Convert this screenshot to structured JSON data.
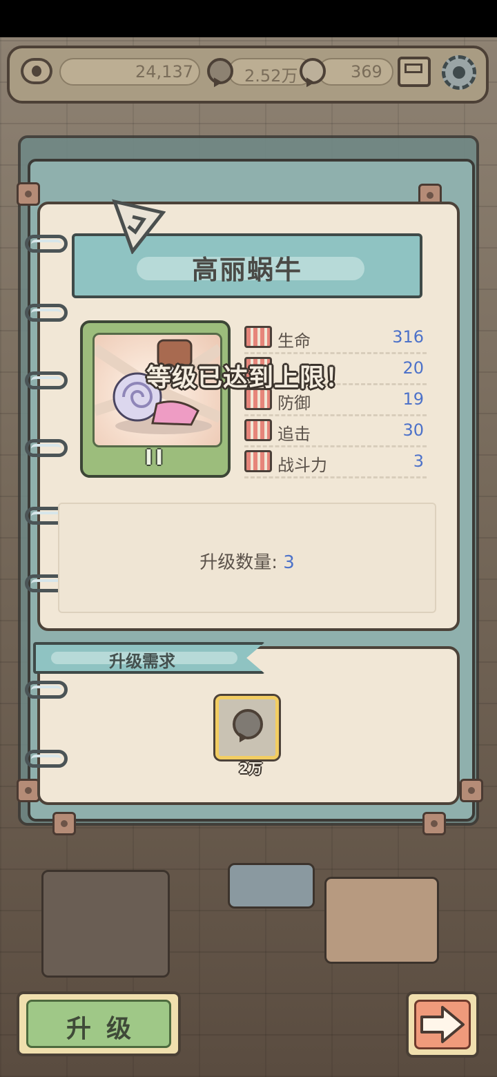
{
  "resources": {
    "views": "24,137",
    "bubbles": "2.52万",
    "gems": "369"
  },
  "card": {
    "title": "高丽蜗牛",
    "level_roman": "II",
    "stats": [
      {
        "label": "生命",
        "value": "316",
        "icon": "health-icon"
      },
      {
        "label": "",
        "value": "20",
        "icon": "attack-icon"
      },
      {
        "label": "防御",
        "value": "19",
        "icon": "defense-icon"
      },
      {
        "label": "追击",
        "value": "30",
        "icon": "pursuit-icon"
      },
      {
        "label": "战斗力",
        "value": "3",
        "icon": "power-icon"
      }
    ],
    "upgrade_count_label": "升级数量:",
    "upgrade_count_value": "3"
  },
  "toast": "等级已达到上限！",
  "requirements": {
    "title": "升级需求",
    "items": [
      {
        "icon": "bubble-currency-icon",
        "amount": "2万"
      }
    ]
  },
  "buttons": {
    "upgrade": "升级",
    "next_icon": "arrow-right-icon"
  }
}
